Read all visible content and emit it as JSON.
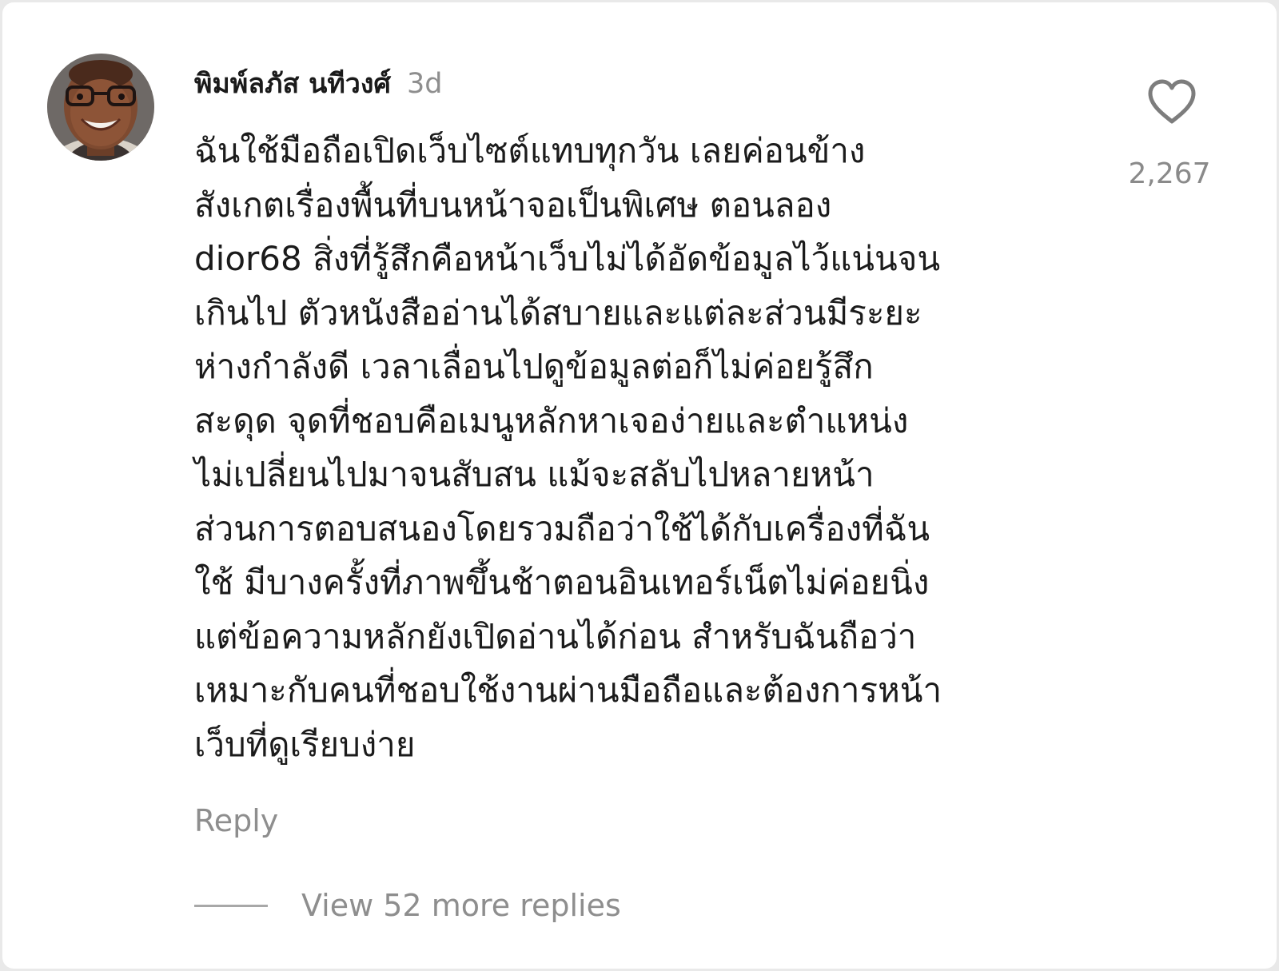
{
  "comment": {
    "username": "พิมพ์ลภัส นทีวงศ์",
    "timestamp": "3d",
    "lines": [
      "ฉันใช้มือถือเปิดเว็บไซต์แทบทุกวัน เลยค่อนข้าง",
      "สังเกตเรื่องพื้นที่บนหน้าจอเป็นพิเศษ ตอนลอง",
      "dior68 สิ่งที่รู้สึกคือหน้าเว็บไม่ได้อัดข้อมูลไว้แน่นจน",
      "เกินไป ตัวหนังสืออ่านได้สบายและแต่ละส่วนมีระยะ",
      "ห่างกำลังดี เวลาเลื่อนไปดูข้อมูลต่อก็ไม่ค่อยรู้สึก",
      "สะดุด จุดที่ชอบคือเมนูหลักหาเจอง่ายและตำแหน่ง",
      "ไม่เปลี่ยนไปมาจนสับสน แม้จะสลับไปหลายหน้า",
      "ส่วนการตอบสนองโดยรวมถือว่าใช้ได้กับเครื่องที่ฉัน",
      "ใช้ มีบางครั้งที่ภาพขึ้นช้าตอนอินเทอร์เน็ตไม่ค่อยนิ่ง",
      "แต่ข้อความหลักยังเปิดอ่านได้ก่อน สำหรับฉันถือว่า",
      "เหมาะกับคนที่ชอบใช้งานผ่านมือถือและต้องการหน้า",
      "เว็บที่ดูเรียบง่าย"
    ],
    "like_count": "2,267",
    "reply_label": "Reply",
    "view_replies_label": "View 52 more replies"
  },
  "icons": {
    "like": "heart-outline-icon",
    "avatar": "user-avatar-photo"
  },
  "colors": {
    "text_primary": "#1b1b1b",
    "text_secondary": "#8e8e8e",
    "background": "#ffffff",
    "page_border": "#e9e9e9"
  }
}
